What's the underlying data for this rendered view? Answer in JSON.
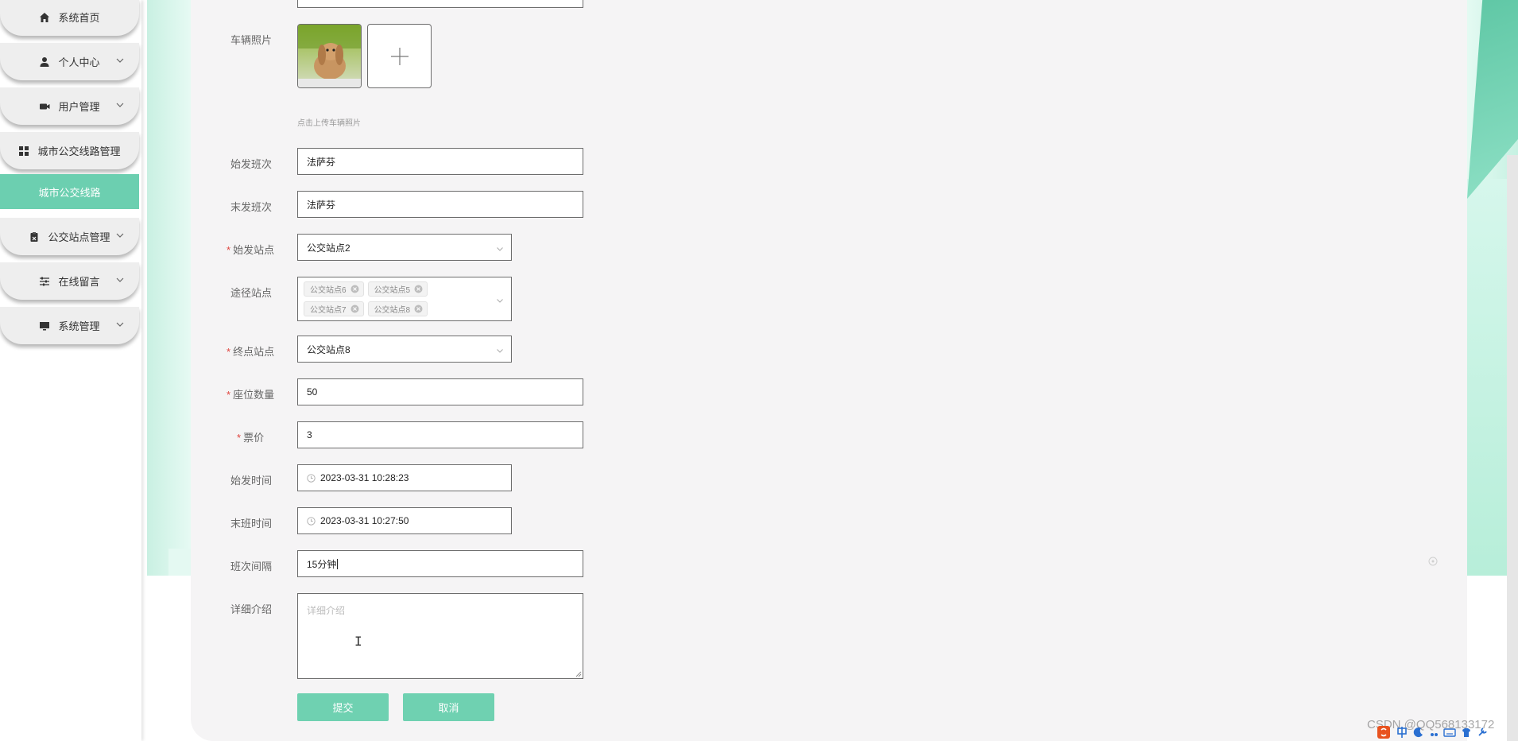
{
  "sidebar": {
    "items": [
      {
        "label": "系统首页",
        "icon": "home-icon",
        "has_chevron": false
      },
      {
        "label": "个人中心",
        "icon": "user-icon",
        "has_chevron": true
      },
      {
        "label": "用户管理",
        "icon": "camera-icon",
        "has_chevron": true
      },
      {
        "label": "城市公交线路管理",
        "icon": "grid-icon",
        "has_chevron": false
      },
      {
        "label": "城市公交线路",
        "active": true
      },
      {
        "label": "公交站点管理",
        "icon": "clipboard-icon",
        "has_chevron": true
      },
      {
        "label": "在线留言",
        "icon": "sliders-icon",
        "has_chevron": true
      },
      {
        "label": "系统管理",
        "icon": "monitor-icon",
        "has_chevron": true
      }
    ]
  },
  "form": {
    "vehicle_photo": {
      "label": "车辆照片",
      "hint": "点击上传车辆照片"
    },
    "first_trip": {
      "label": "始发班次",
      "value": "法萨芬"
    },
    "last_trip": {
      "label": "末发班次",
      "value": "法萨芬"
    },
    "start_station": {
      "label": "始发站点",
      "value": "公交站点2",
      "required": true
    },
    "via_stations": {
      "label": "途径站点",
      "tags": [
        "公交站点6",
        "公交站点5",
        "公交站点7",
        "公交站点8"
      ]
    },
    "end_station": {
      "label": "终点站点",
      "value": "公交站点8",
      "required": true
    },
    "seats": {
      "label": "座位数量",
      "value": "50",
      "required": true
    },
    "fare": {
      "label": "票价",
      "value": "3",
      "required": true
    },
    "start_time": {
      "label": "始发时间",
      "value": "2023-03-31 10:28:23"
    },
    "last_time": {
      "label": "末班时间",
      "value": "2023-03-31 10:27:50"
    },
    "interval": {
      "label": "班次间隔",
      "value": "15分钟"
    },
    "details": {
      "label": "详细介绍",
      "placeholder": "详细介绍"
    },
    "submit_label": "提交",
    "cancel_label": "取消"
  },
  "watermark": "CSDN @QQ568133172",
  "colors": {
    "accent": "#6ccfb0",
    "button": "#6fd1b1",
    "required": "#e0453f",
    "panel": "#f5f4f5"
  }
}
